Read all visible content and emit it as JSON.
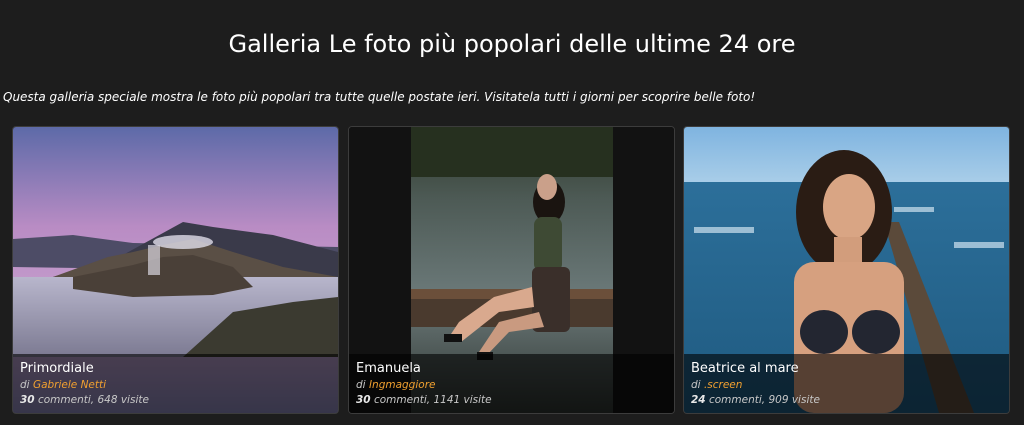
{
  "header": {
    "title": "Galleria Le foto più popolari delle ultime 24 ore",
    "description": "Questa galleria speciale mostra le foto più popolari tra tutte quelle postate ieri. Visitatela tutti i giorni per scoprire belle foto!"
  },
  "labels": {
    "by": "di",
    "comments": "commenti,",
    "visits": "visite"
  },
  "photos": [
    {
      "title": "Primordiale",
      "author": "Gabriele Netti",
      "comments": "30",
      "visits": "648"
    },
    {
      "title": "Emanuela",
      "author": "Ingmaggiore",
      "comments": "30",
      "visits": "1141"
    },
    {
      "title": "Beatrice al mare",
      "author": ".screen",
      "comments": "24",
      "visits": "909"
    }
  ],
  "colors": {
    "background": "#1d1d1d",
    "author_link": "#f0a030"
  }
}
